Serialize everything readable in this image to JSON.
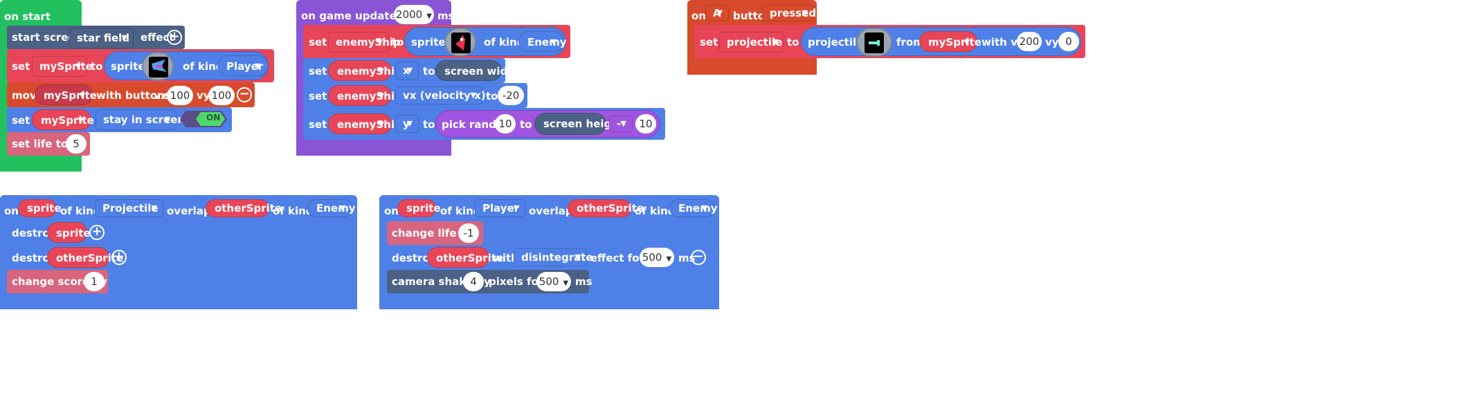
{
  "colors": {
    "green": "#22c05f",
    "slate": "#4b6185",
    "red": "#e84658",
    "scene": "#d84a2c",
    "purple": "#8a54d6",
    "blue": "#4f80e8",
    "pink": "#d8657d",
    "pink_light": "#e06b84"
  },
  "on_start": {
    "title": "on start",
    "start_screen": {
      "label": "start screen",
      "effect": "star field",
      "effect_word": "effect"
    },
    "set_player": {
      "set": "set",
      "var": "mySprite",
      "to": "to",
      "sprite": "sprite",
      "of_kind": "of kind",
      "kind": "Player"
    },
    "move": {
      "label": "move",
      "var": "mySprite",
      "with_buttons": "with buttons",
      "vx_label": "vx",
      "vx": "100",
      "vy_label": "vy",
      "vy": "100"
    },
    "stay": {
      "set": "set",
      "var": "mySprite",
      "prop": "stay in screen",
      "toggle": "ON"
    },
    "life": {
      "label": "set life to",
      "value": "5"
    }
  },
  "game_update": {
    "title": "on game update every",
    "interval": "2000",
    "unit": "ms",
    "set_enemy": {
      "set": "set",
      "var": "enemyShip",
      "to": "to",
      "sprite": "sprite",
      "of_kind": "of kind",
      "kind": "Enemy"
    },
    "set_x": {
      "set": "set",
      "var": "enemyShip",
      "prop": "x",
      "to": "to",
      "value": "screen width"
    },
    "set_vx": {
      "set": "set",
      "var": "enemyShip",
      "prop": "vx (velocity x)",
      "to": "to",
      "value": "-20"
    },
    "set_y": {
      "set": "set",
      "var": "enemyShip",
      "prop": "y",
      "to": "to",
      "pick": "pick random",
      "from": "10",
      "to2": "to",
      "height": "screen height",
      "op": "-",
      "sub": "10"
    }
  },
  "button_a": {
    "on": "on",
    "button": "A",
    "button_word": "button",
    "state": "pressed",
    "set_proj": {
      "set": "set",
      "var": "projectile",
      "to": "to",
      "proj": "projectile",
      "from": "from",
      "src": "mySprite",
      "with_vx": "with vx",
      "vx": "200",
      "vy_label": "vy",
      "vy": "0"
    }
  },
  "overlap1": {
    "on": "on",
    "a": "sprite",
    "of_kind": "of kind",
    "kind_a": "Projectile",
    "overlaps": "overlaps",
    "b": "otherSprite",
    "of_kind2": "of kind",
    "kind_b": "Enemy",
    "destroy1": {
      "label": "destroy",
      "var": "sprite"
    },
    "destroy2": {
      "label": "destroy",
      "var": "otherSprite"
    },
    "score": {
      "label": "change score by",
      "value": "1"
    }
  },
  "overlap2": {
    "on": "on",
    "a": "sprite",
    "of_kind": "of kind",
    "kind_a": "Player",
    "overlaps": "overlaps",
    "b": "otherSprite",
    "of_kind2": "of kind",
    "kind_b": "Enemy",
    "life": {
      "label": "change life by",
      "value": "-1"
    },
    "destroy": {
      "label": "destroy",
      "var": "otherSprite",
      "with": "with",
      "effect": "disintegrate",
      "effect_for": "effect for",
      "ms": "500",
      "unit": "ms"
    },
    "shake": {
      "label": "camera shake by",
      "value": "4",
      "pixels_for": "pixels for",
      "ms": "500",
      "unit": "ms"
    }
  }
}
